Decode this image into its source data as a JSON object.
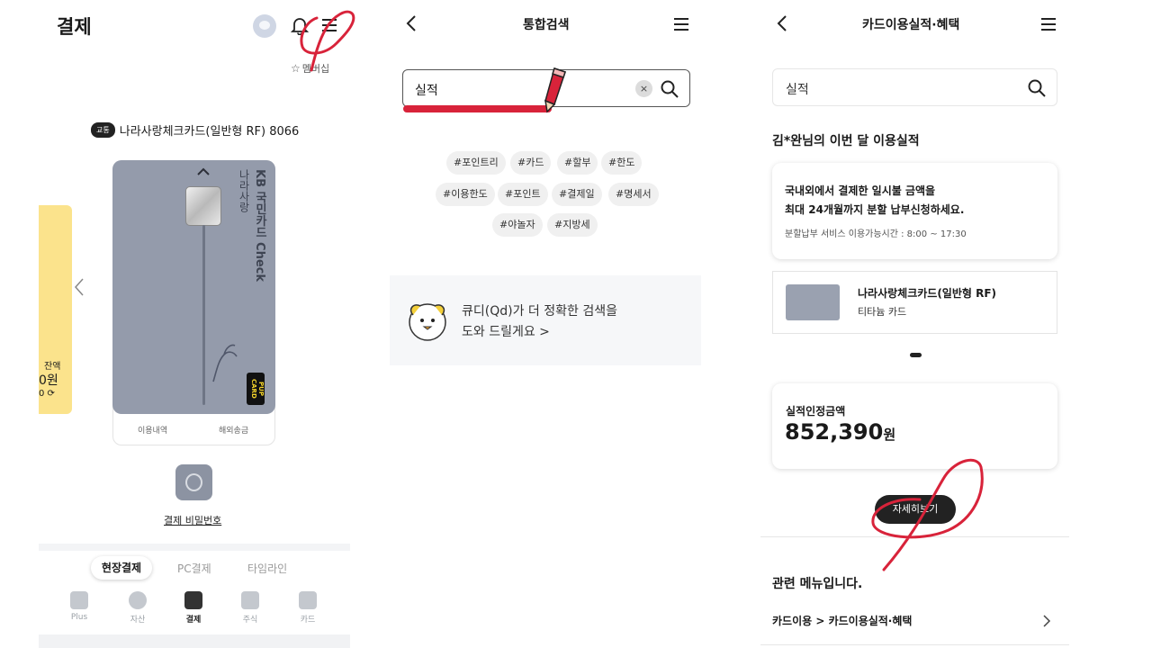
{
  "payment": {
    "title": "결제",
    "membership": "멤버십",
    "card_badge": "교통",
    "card_name": "나라사랑체크카드(일반형 RF) 8066",
    "side_card": {
      "label": "잔액",
      "amount": "0원",
      "sub": "0"
    },
    "card_vertical_brand": "KB 국민카드 Check",
    "card_vertical_name": "나라사랑",
    "card_logo": "PUP CARD",
    "card_tab_history": "이용내역",
    "card_tab_remit": "해외송금",
    "password_label": "결제 비밀번호",
    "tabs": [
      "현장결제",
      "PC결제",
      "타임라인"
    ],
    "nav": [
      "Plus",
      "자산",
      "결제",
      "주식",
      "카드"
    ]
  },
  "search": {
    "title": "통합검색",
    "query": "실적",
    "clear_icon": "×",
    "tags_row1": [
      "#포인트리",
      "#카드",
      "#할부",
      "#한도"
    ],
    "tags_row2": [
      "#이용한도",
      "#포인트",
      "#결제일",
      "#명세서"
    ],
    "tags_row3": [
      "#야놀자",
      "#지방세"
    ],
    "qd_line1": "큐디(Qd)가 더 정확한 검색을",
    "qd_line2": "도와 드릴게요 >"
  },
  "performance": {
    "title": "카드이용실적·혜택",
    "query": "실적",
    "heading": "김*완님의 이번 달 이용실적",
    "info_line1": "국내외에서 결제한 일시불 금액을",
    "info_line2": "최대 24개월까지 분할 납부신청하세요.",
    "info_line3": "분할납부 서비스 이용가능시간 : 8:00 ~ 17:30",
    "card_name": "나라사랑체크카드(일반형 RF)",
    "card_sub": "티타늄 카드",
    "amount_label": "실적인정금액",
    "amount": "852,390",
    "amount_unit": "원",
    "detail_button": "자세히보기",
    "related_heading": "관련 메뉴입니다.",
    "related_link": "카드이용 > 카드이용실적·혜택"
  },
  "colors": {
    "annotation_red": "#d8233a",
    "card_gray": "#949bab",
    "side_card_yellow": "#fbe38c"
  }
}
